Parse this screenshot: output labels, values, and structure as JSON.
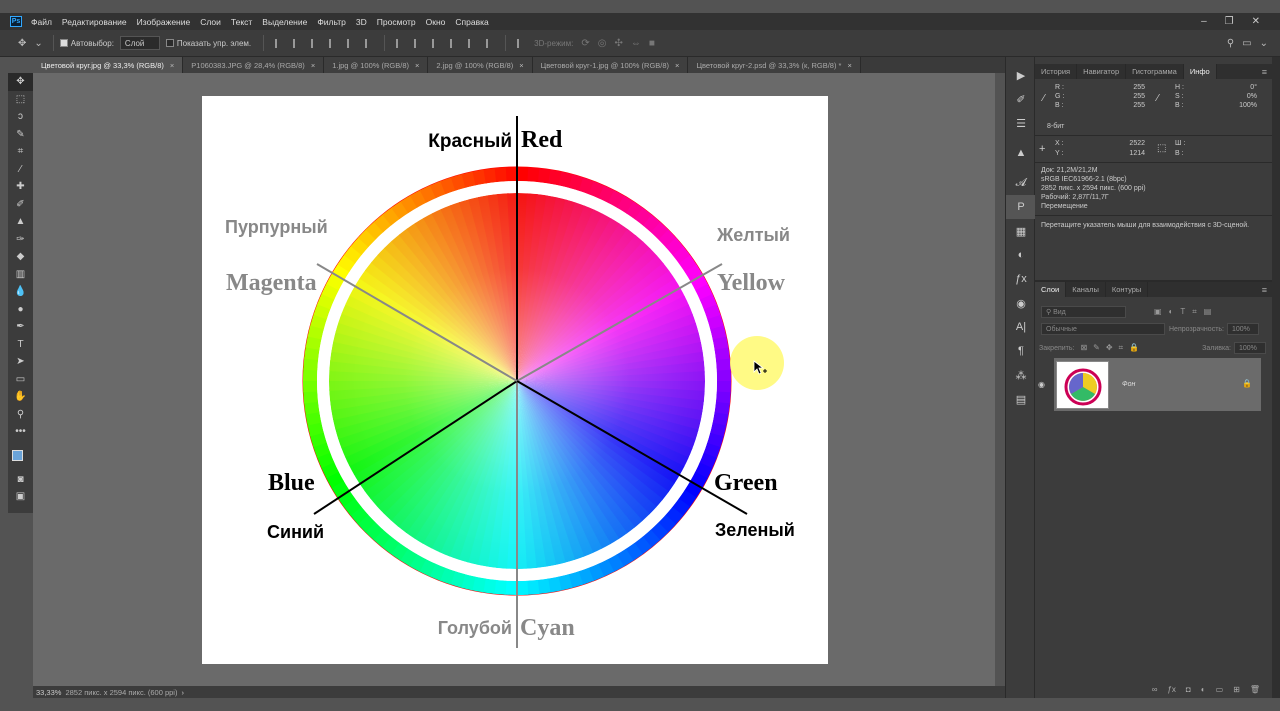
{
  "app": {
    "logo": "Ps"
  },
  "menu": [
    "Файл",
    "Редактирование",
    "Изображение",
    "Слои",
    "Текст",
    "Выделение",
    "Фильтр",
    "3D",
    "Просмотр",
    "Окно",
    "Справка"
  ],
  "window_controls": [
    "–",
    "❐",
    "✕"
  ],
  "options": {
    "autoselect_label": "Автовыбор:",
    "autoselect_value": "Слой",
    "show_transform_label": "Показать упр. элем.",
    "mode_3d": "3D-режим:"
  },
  "tabs": [
    {
      "label": "Цветовой круг.jpg @ 33,3% (RGB/8)",
      "close": "×",
      "active": true
    },
    {
      "label": "P1060383.JPG @ 28,4% (RGB/8)",
      "close": "×",
      "active": false
    },
    {
      "label": "1.jpg @ 100% (RGB/8)",
      "close": "×",
      "active": false
    },
    {
      "label": "2.jpg @ 100% (RGB/8)",
      "close": "×",
      "active": false
    },
    {
      "label": "Цветовой круг-1.jpg @ 100% (RGB/8)",
      "close": "×",
      "active": false
    },
    {
      "label": "Цветовой круг-2.psd @ 33,3% (к, RGB/8) *",
      "close": "×",
      "active": false
    }
  ],
  "tools": [
    "move-tool",
    "marquee-tool",
    "lasso-tool",
    "quick-select-tool",
    "crop-tool",
    "eyedropper-tool",
    "healing-tool",
    "brush-tool",
    "stamp-tool",
    "history-brush-tool",
    "eraser-tool",
    "gradient-tool",
    "blur-tool",
    "dodge-tool",
    "pen-tool",
    "type-tool",
    "path-select-tool",
    "shape-tool",
    "hand-tool",
    "zoom-tool",
    "more-tools"
  ],
  "colors": {
    "foreground": "#6aa3d8",
    "background": "#ffffff"
  },
  "canvas": {
    "labels": {
      "red_ru": "Красный",
      "red_en": "Red",
      "yellow_ru": "Желтый",
      "yellow_en": "Yellow",
      "green_en": "Green",
      "green_ru": "Зеленый",
      "cyan_ru": "Голубой",
      "cyan_en": "Cyan",
      "blue_en": "Blue",
      "blue_ru": "Синий",
      "magenta_ru": "Пурпурный",
      "magenta_en": "Magenta"
    }
  },
  "status": {
    "zoom": "33,33%",
    "info": "2852 пикс. x 2594 пикс. (600 ppi)",
    "arrow": "›"
  },
  "info_panel": {
    "tabs": [
      "История",
      "Навигатор",
      "Гистограмма",
      "Инфо"
    ],
    "active_tab": "Инфо",
    "rgb": {
      "r_label": "R :",
      "g_label": "G :",
      "b_label": "B :",
      "r": "255",
      "g": "255",
      "b": "255"
    },
    "hsb": {
      "h_label": "H :",
      "s_label": "S :",
      "b_label": "B :",
      "h": "0°",
      "s": "0%",
      "b": "100%"
    },
    "bit_depth": "8-бит",
    "xy": {
      "x_label": "X :",
      "y_label": "Y :",
      "x": "2522",
      "y": "1214"
    },
    "wh": {
      "w_label": "Ш :",
      "h_label": "В :"
    },
    "doc_lines": [
      "Док: 21,2M/21,2M",
      "sRGB IEC61966-2.1 (8bpc)",
      "2852 пикс. x 2594 пикс. (600 ppi)",
      "Рабочий: 2,87Г/11,7Г",
      "Перемещение"
    ],
    "hint": "Перетащите указатель мыши для взаимодействия с 3D-сценой."
  },
  "layers_panel": {
    "tabs": [
      "Слои",
      "Каналы",
      "Контуры"
    ],
    "active_tab": "Слои",
    "filter_placeholder": "Вид",
    "blend_mode": "Обычные",
    "opacity_label": "Непрозрачность:",
    "opacity_value": "100%",
    "lock_label": "Закрепить:",
    "fill_label": "Заливка:",
    "fill_value": "100%",
    "layer_name": "Фон"
  }
}
